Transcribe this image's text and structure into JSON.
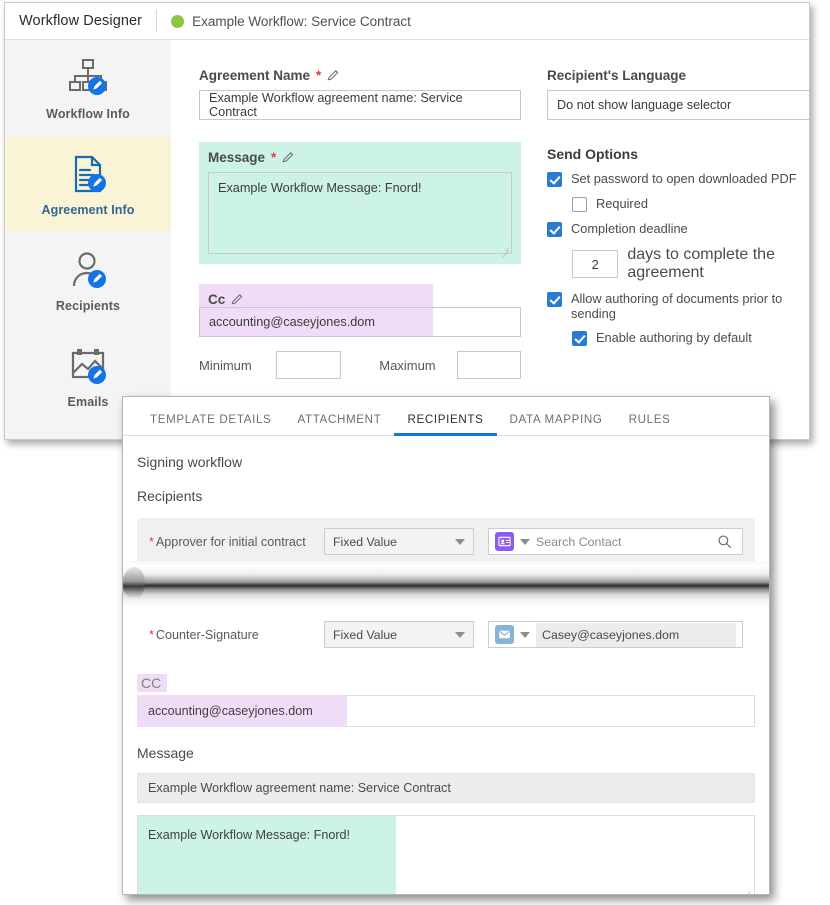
{
  "app": {
    "title": "Workflow Designer",
    "status_dot_color": "#8cc63f",
    "subtitle": "Example Workflow: Service Contract"
  },
  "rail": {
    "items": [
      {
        "label": "Workflow Info",
        "icon": "workflow-info-icon",
        "selected": false
      },
      {
        "label": "Agreement Info",
        "icon": "agreement-info-icon",
        "selected": true
      },
      {
        "label": "Recipients",
        "icon": "recipients-icon",
        "selected": false
      },
      {
        "label": "Emails",
        "icon": "emails-icon",
        "selected": false
      }
    ]
  },
  "form": {
    "agreement_name": {
      "label": "Agreement Name",
      "required_mark": "*",
      "value": "Example Workflow agreement name: Service Contract"
    },
    "message": {
      "label": "Message",
      "required_mark": "*",
      "value": "Example Workflow Message: Fnord!",
      "highlight_color": "#cdf3e8"
    },
    "cc": {
      "label": "Cc",
      "value": "accounting@caseyjones.dom",
      "highlight_color": "#f0dcf6"
    },
    "minimum": {
      "label": "Minimum",
      "value": ""
    },
    "maximum": {
      "label": "Maximum",
      "value": ""
    },
    "recipients_language": {
      "label": "Recipient's Language",
      "value": "Do not show language selector"
    },
    "send_options": {
      "title": "Send Options",
      "options": [
        {
          "label": "Set password to open downloaded PDF",
          "checked": true,
          "indent": false
        },
        {
          "label": "Required",
          "checked": false,
          "indent": true
        },
        {
          "label": "Completion deadline",
          "checked": true,
          "indent": false
        },
        {
          "label": "Allow authoring of documents prior to sending",
          "checked": true,
          "indent": false
        },
        {
          "label": "Enable authoring by default",
          "checked": true,
          "indent": true
        }
      ],
      "deadline_days": "2",
      "deadline_suffix": "days to complete the agreement"
    }
  },
  "overlay": {
    "tabs": [
      {
        "label": "TEMPLATE DETAILS",
        "active": false
      },
      {
        "label": "ATTACHMENT",
        "active": false
      },
      {
        "label": "RECIPIENTS",
        "active": true
      },
      {
        "label": "DATA MAPPING",
        "active": false
      },
      {
        "label": "RULES",
        "active": false
      }
    ],
    "active_tab_color": "#1473e6",
    "signing_workflow_heading": "Signing workflow",
    "recipients_heading": "Recipients",
    "recipient_rows": [
      {
        "name": "Approver for initial contract",
        "required_mark": "*",
        "source_label": "Fixed Value",
        "type_icon": "contact-card-icon",
        "type_icon_color": "#8b5cf0",
        "value": "",
        "placeholder": "Search Contact",
        "has_search_icon": true
      },
      {
        "name": "Counter-Signature",
        "required_mark": "*",
        "source_label": "Fixed Value",
        "type_icon": "envelope-icon",
        "type_icon_color": "#86b3d6",
        "value": "Casey@caseyjones.dom",
        "placeholder": "",
        "has_search_icon": false
      }
    ],
    "cc": {
      "label": "CC",
      "value": "accounting@caseyjones.dom",
      "highlight_color": "#f0dcf6"
    },
    "message": {
      "label": "Message",
      "subject_value": "Example Workflow agreement name: Service Contract",
      "body_value": "Example Workflow Message: Fnord!",
      "highlight_color": "#cdf3e8"
    }
  }
}
